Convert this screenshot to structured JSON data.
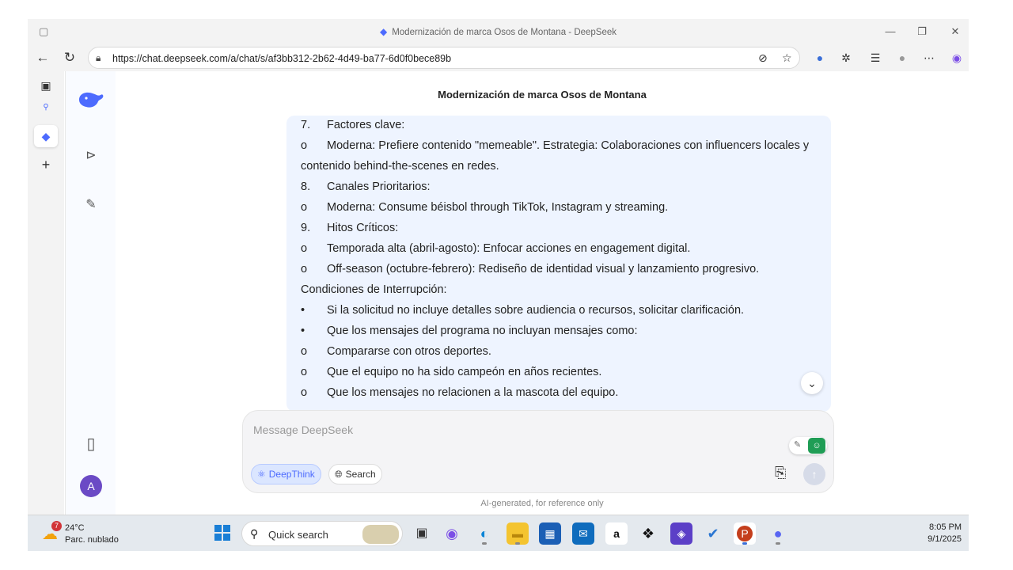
{
  "browser": {
    "tab_title": "Modernización de marca Osos de Montana - DeepSeek",
    "url": "https://chat.deepseek.com/a/chat/s/af3bb312-2b62-4d49-ba77-6d0f0bece89b"
  },
  "app": {
    "chat_title": "Modernización de marca Osos de Montana",
    "avatar_letter": "A",
    "message_lines": [
      {
        "marker": "7.",
        "text": "Factores clave:"
      },
      {
        "marker": "o",
        "text": "Moderna: Prefiere contenido \"memeable\". Estrategia: Colaboraciones con influencers locales y"
      },
      {
        "marker": "",
        "text": "contenido behind-the-scenes en redes."
      },
      {
        "marker": "8.",
        "text": "Canales Prioritarios:"
      },
      {
        "marker": "o",
        "text": "Moderna: Consume béisbol through TikTok, Instagram y streaming."
      },
      {
        "marker": "9.",
        "text": "Hitos Críticos:"
      },
      {
        "marker": "o",
        "text": "Temporada alta (abril-agosto): Enfocar acciones en engagement digital."
      },
      {
        "marker": "o",
        "text": "Off-season (octubre-febrero): Rediseño de identidad visual y lanzamiento progresivo."
      },
      {
        "marker": "",
        "text": "Condiciones de Interrupción:"
      },
      {
        "marker": "•",
        "text": "Si la solicitud no incluye detalles sobre audiencia o recursos, solicitar clarificación."
      },
      {
        "marker": "•",
        "text": "Que los mensajes del programa no incluyan mensajes como:"
      },
      {
        "marker": "o",
        "text": "Compararse con otros deportes."
      },
      {
        "marker": "o",
        "text": "Que el equipo no ha sido campeón en años recientes."
      },
      {
        "marker": "o",
        "text": "Que los mensajes no relacionen a la mascota del equipo."
      }
    ],
    "composer": {
      "placeholder": "Message DeepSeek",
      "deepthink_label": "DeepThink",
      "search_label": "Search"
    },
    "footnote": "AI-generated, for reference only",
    "accent_color": "#4d6bfe"
  },
  "taskbar": {
    "weather_temp": "24°C",
    "weather_desc": "Parc. nublado",
    "weather_badge": "7",
    "search_label": "Quick search",
    "time": "8:05 PM",
    "date": "9/1/2025"
  }
}
